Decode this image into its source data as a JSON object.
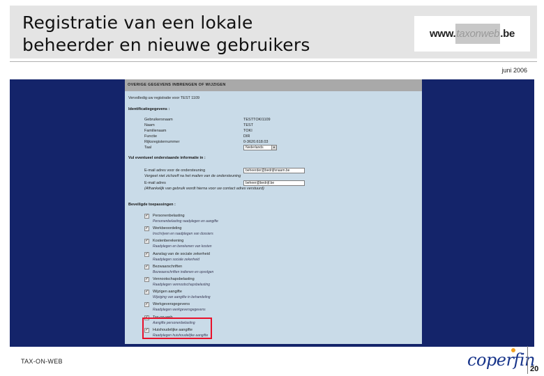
{
  "slide": {
    "title_line1": "Registratie van een lokale",
    "title_line2": "beheerder en nieuwe gebruikers",
    "logo": {
      "pre": "www.",
      "mid": "taxonweb",
      "post": ".be"
    },
    "date": "juni 2006",
    "footer_left": "TAX-ON-WEB",
    "footer_brand": "coperfin",
    "page_number": "20"
  },
  "form": {
    "header": "OVERIGE GEGEVENS INBRENGEN OF WIJZIGEN",
    "subheader": "Vervolledig uw registratie voor TEST 1109",
    "ident_section": "Identificatiegegevens :",
    "ident_fields": [
      {
        "label": "Gebruikersnaam",
        "value": "TESTTOKI1109"
      },
      {
        "label": "Naam",
        "value": "TEST"
      },
      {
        "label": "Familienaam",
        "value": "TOKI"
      },
      {
        "label": "Functie",
        "value": "DIR"
      },
      {
        "label": "Rijksregisternummer",
        "value": "0-3620.618.03"
      },
      {
        "label": "Taal",
        "value": "Nederlands"
      }
    ],
    "contact_section": "Vul eventueel onderstaande informatie in :",
    "contact_fields": [
      {
        "label": "E-mail adres voor de ondersteuning",
        "value": "beheerder@bedrijfsnaam.be",
        "note": "Vergeet niet zichzelf na het mailen van de ondersteuning"
      },
      {
        "label": "E-mail adres",
        "value": "beheer@bedrijf.be",
        "note": "(Afhankelijk van gebruik wordt hierna voor uw contact adres verstuurd)"
      }
    ],
    "apps_section": "Beveiligde toepassingen :",
    "apps": [
      {
        "name": "Personenbelasting",
        "desc": "Personenbelasting raadplegen en aangifte"
      },
      {
        "name": "Werkbeoordeling",
        "desc": "Inschrijven en raadplegen van dossiers"
      },
      {
        "name": "Kostenberekening",
        "desc": "Raadplegen en berekenen van kosten"
      },
      {
        "name": "Aanslag van de sociale zekerheid",
        "desc": "Raadplegen sociale zekerheid"
      },
      {
        "name": "Bezwaarschriften",
        "desc": "Bezwaarschriften indienen en opvolgen"
      },
      {
        "name": "Vennootschapsbelasting",
        "desc": "Raadplegen vennootschapsbelasting"
      },
      {
        "name": "Wijzigen aangifte",
        "desc": "Wijziging van aangifte in behandeling"
      },
      {
        "name": "Werkgeversgegevens",
        "desc": "Raadplegen werkgeversgegevens"
      },
      {
        "name": "Tax-on-web",
        "desc": "Aangifte personenbelasting"
      },
      {
        "name": "Huishoudelijke aangifte",
        "desc": "Raadplegen huishoudelijke aangifte"
      }
    ]
  }
}
